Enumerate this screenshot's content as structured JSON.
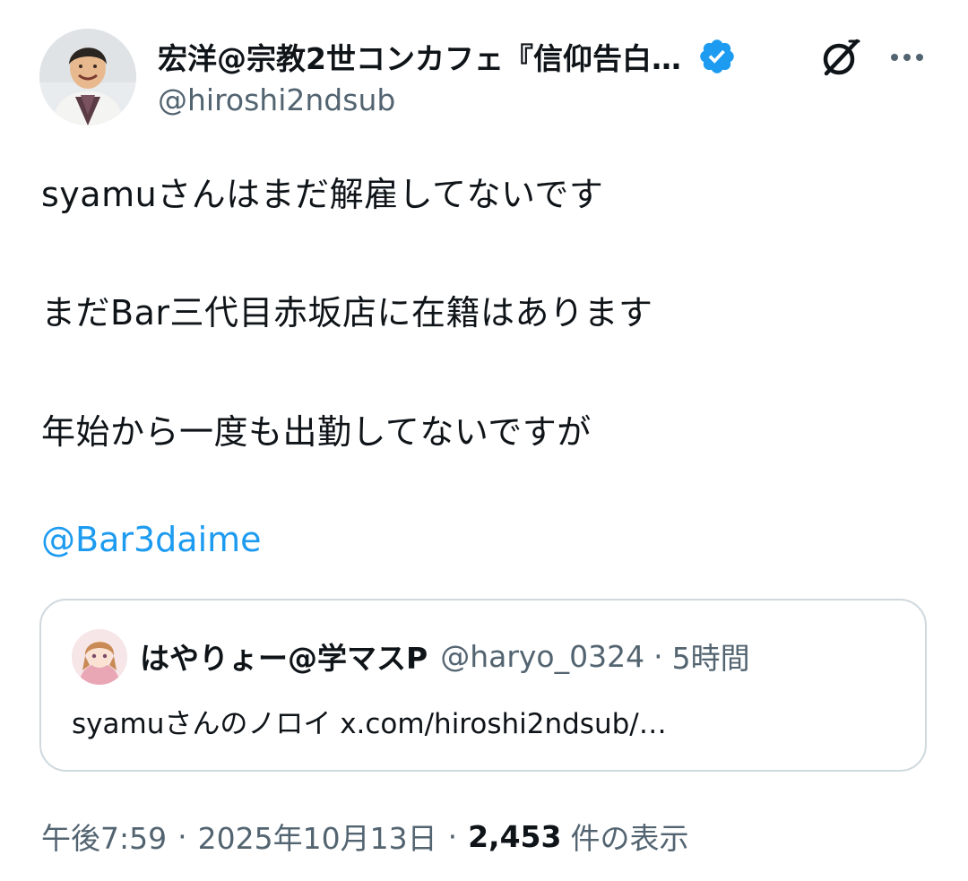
{
  "author": {
    "display_name": "宏洋@宗教2世コンカフェ『信仰告白…",
    "handle": "@hiroshi2ndsub",
    "verified_icon": "verified-badge-icon",
    "avatar_icon": "profile-photo"
  },
  "actions": {
    "grok_icon": "grok-icon",
    "more_icon": "more-options-icon"
  },
  "body": {
    "line1": "syamuさんはまだ解雇してないです",
    "line2": "まだBar三代目赤坂店に在籍はあります",
    "line3": "年始から一度も出勤してないですが",
    "mention": "@Bar3daime"
  },
  "quote": {
    "display_name": "はやりょー@学マスP",
    "handle": "@haryo_0324",
    "dot": "·",
    "time": "5時間",
    "text": "syamuさんのノロイ x.com/hiroshi2ndsub/…"
  },
  "meta": {
    "time": "午後7:59",
    "sep1": "·",
    "date": "2025年10月13日",
    "sep2": "·",
    "views_count": "2,453",
    "views_label": "件の表示"
  },
  "colors": {
    "link": "#1d9bf0",
    "text": "#0f1419",
    "secondary": "#536471",
    "border": "#cfd9de"
  }
}
